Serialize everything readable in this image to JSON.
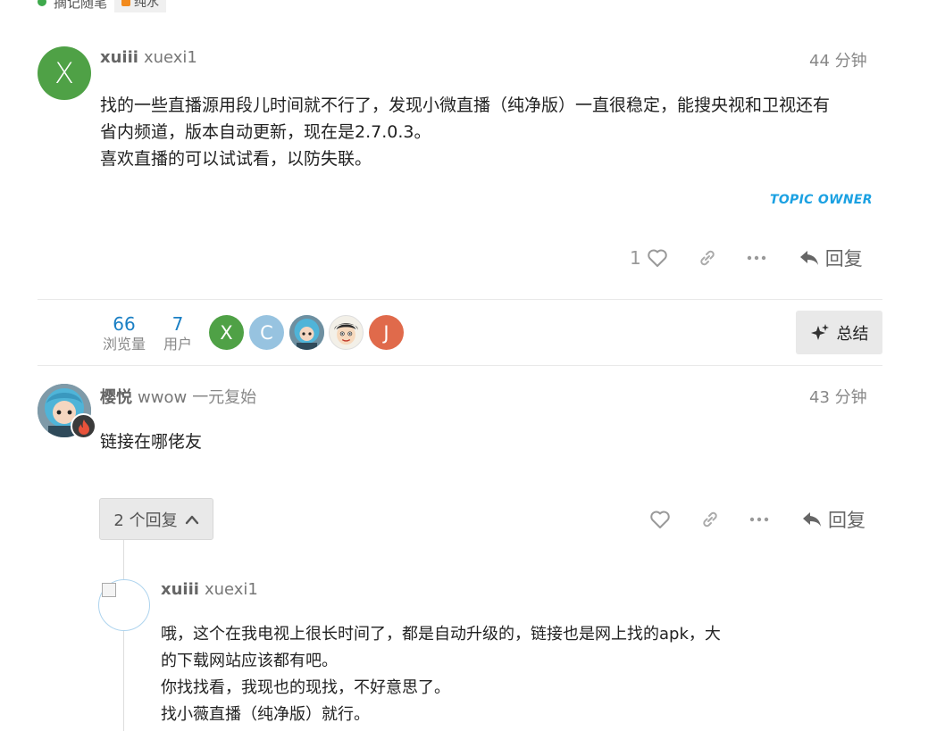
{
  "top_strip": {
    "text": "摘记随笔",
    "tag": "纯水"
  },
  "post1": {
    "avatar_letter": "X",
    "username": "xuiii",
    "fullname": "xuexi1",
    "time": "44 分钟",
    "body": [
      "找的一些直播源用段儿时间就不行了，发现小微直播（纯净版）一直很稳定，能搜央视和卫视还有",
      "省内频道，版本自动更新，现在是2.7.0.3。",
      "喜欢直播的可以试试看，以防失联。"
    ],
    "badge": "TOPIC OWNER",
    "like_count": "1",
    "reply_label": "回复"
  },
  "topic_map": {
    "views": {
      "num": "66",
      "label": "浏览量"
    },
    "users": {
      "num": "7",
      "label": "用户"
    },
    "participants": [
      {
        "letter": "X",
        "color": "#4fa146"
      },
      {
        "letter": "C",
        "color": "#97c3e0"
      },
      {
        "letter": "",
        "color": "#5aa7c9"
      },
      {
        "letter": "",
        "color": "#f3f0e8"
      },
      {
        "letter": "J",
        "color": "#e06a4b"
      }
    ],
    "summary_label": "总结"
  },
  "post2": {
    "username": "樱悦",
    "fullname": "wwow",
    "title": "一元复始",
    "time": "43 分钟",
    "body": [
      "链接在哪佬友"
    ],
    "replies_label": "2 个回复",
    "reply_label": "回复"
  },
  "reply1": {
    "username": "xuiii",
    "fullname": "xuexi1",
    "body": [
      "哦，这个在我电视上很长时间了，都是自动升级的，链接也是网上找的apk，大",
      "的下载网站应该都有吧。",
      "你找找看，我现也的现找，不好意思了。",
      "找小薇直播（纯净版）就行。"
    ]
  },
  "icons": {
    "like": "heart-icon",
    "link": "link-icon",
    "more": "ellipsis-icon",
    "reply": "reply-arrow-icon",
    "summary": "sparkle-icon",
    "expand": "chevron-up-icon",
    "flair": "flame-icon"
  }
}
